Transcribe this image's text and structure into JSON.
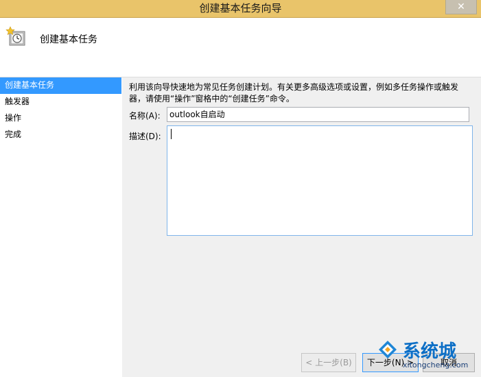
{
  "window": {
    "title": "创建基本任务向导",
    "close_glyph": "✕"
  },
  "header": {
    "title": "创建基本任务"
  },
  "sidebar": {
    "items": [
      {
        "label": "创建基本任务",
        "active": true
      },
      {
        "label": "触发器"
      },
      {
        "label": "操作"
      },
      {
        "label": "完成"
      }
    ]
  },
  "form": {
    "description_line1": "利用该向导快速地为常见任务创建计划。有关更多高级选项或设置，例如多任务操作或触发",
    "description_line2": "器，请使用“操作”窗格中的“创建任务”命令。",
    "name_label": "名称(A):",
    "name_value": "outlook自启动",
    "desc_label": "描述(D):",
    "desc_value": ""
  },
  "buttons": {
    "back": "< 上一步(B)",
    "next": "下一步(N) >",
    "cancel": "取消"
  },
  "watermark": {
    "text": "系统城",
    "url": "xitongcheng.com"
  },
  "colors": {
    "titlebar": "#e9c46a",
    "selection": "#3399ff",
    "watermark": "#0d6fc6"
  }
}
